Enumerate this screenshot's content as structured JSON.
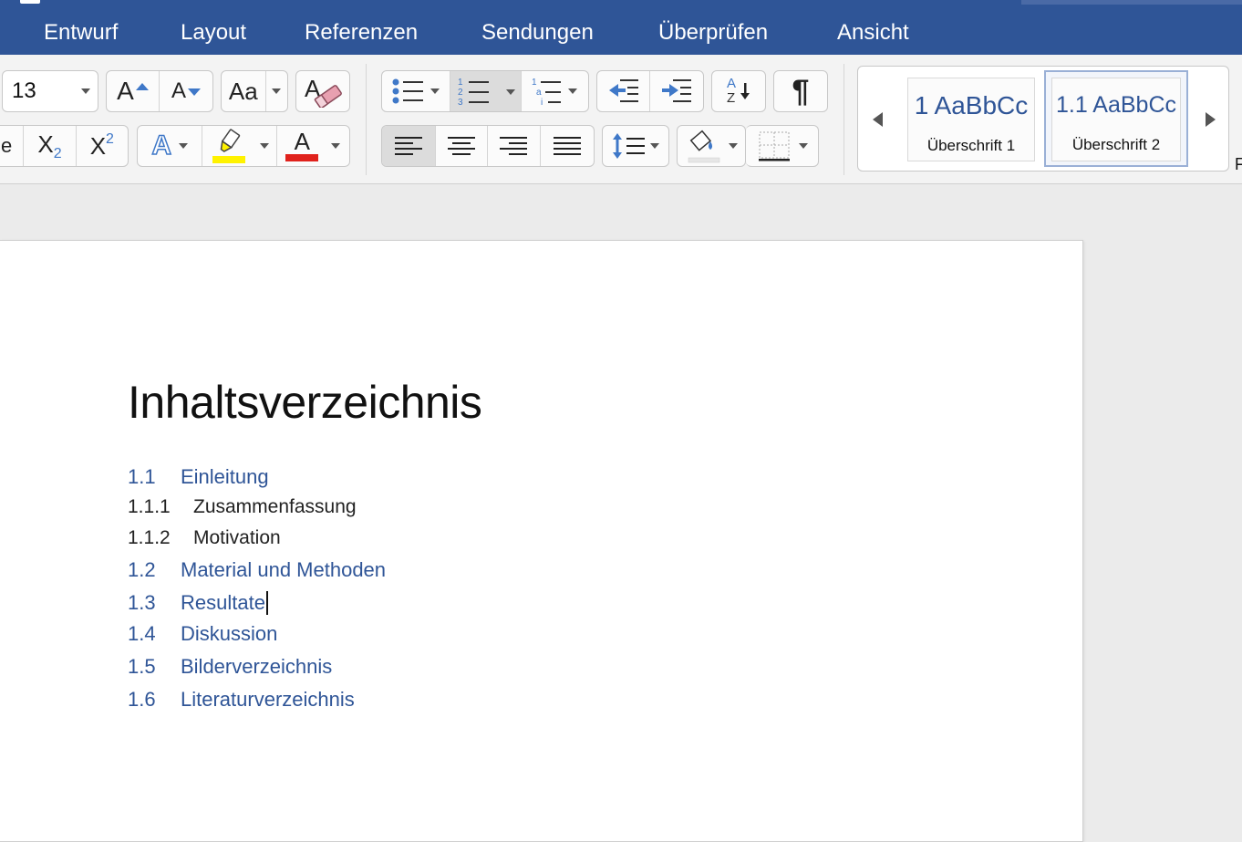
{
  "ribbon_tabs": [
    "Entwurf",
    "Layout",
    "Referenzen",
    "Sendungen",
    "Überprüfen",
    "Ansicht"
  ],
  "font": {
    "size_value": "13",
    "grow_label": "A",
    "shrink_label": "A",
    "change_case_label": "Aa",
    "subscript_label": "X",
    "subscript_index": "2",
    "superscript_label": "X",
    "superscript_index": "2",
    "text_effects_label": "A",
    "font_color_label": "A",
    "highlight_color": "#fff200",
    "font_color": "#e0221c"
  },
  "paragraph": {
    "sort_label_top": "A",
    "sort_label_bottom": "Z",
    "pilcrow": "¶"
  },
  "styles_gallery": [
    {
      "preview": "1  AaBbCc",
      "name": "Überschrift 1",
      "selected": false
    },
    {
      "preview": "1.1  AaBbCc",
      "name": "Überschrift 2",
      "selected": true
    }
  ],
  "gallery_cut_letter": "F",
  "document": {
    "title": "Inhaltsverzeichnis",
    "toc": [
      {
        "num": "1.1",
        "text": "Einleitung",
        "level": 2
      },
      {
        "num": "1.1.1",
        "text": "Zusammenfassung",
        "level": 3
      },
      {
        "num": "1.1.2",
        "text": "Motivation",
        "level": 3
      },
      {
        "num": "1.2",
        "text": "Material und Methoden",
        "level": 2
      },
      {
        "num": "1.3",
        "text": "Resultate",
        "level": 2,
        "cursor": true
      },
      {
        "num": "1.4",
        "text": "Diskussion",
        "level": 2
      },
      {
        "num": "1.5",
        "text": "Bilderverzeichnis",
        "level": 2
      },
      {
        "num": "1.6",
        "text": "Literaturverzeichnis",
        "level": 2
      }
    ]
  },
  "colors": {
    "ribbon_blue": "#2f5597",
    "heading_blue": "#2f5597"
  }
}
